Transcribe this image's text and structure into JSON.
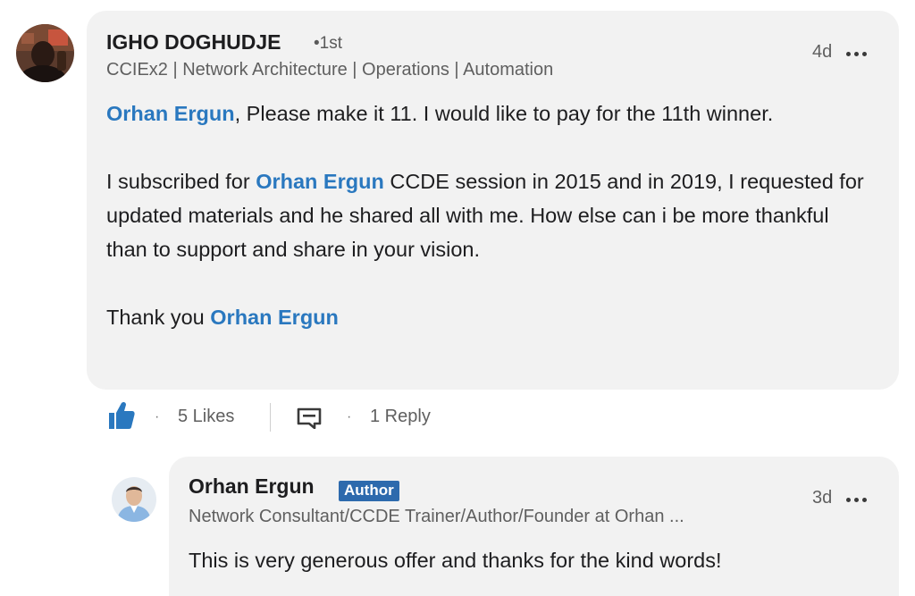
{
  "comment": {
    "author": {
      "name": "IGHO DOGHUDJE",
      "degree": "•1st",
      "headline": "CCIEx2 | Network Architecture | Operations | Automation",
      "avatar_icon": "user-photo-icon"
    },
    "timestamp": "4d",
    "more_icon": "more-options-icon",
    "body": {
      "p1_mention": "Orhan Ergun",
      "p1_text": ", Please make it 11. I would like to pay for the 11th winner.",
      "p2_pre": "I subscribed for ",
      "p2_mention": "Orhan Ergun",
      "p2_text": " CCDE session in 2015 and in 2019, I requested for updated materials and he shared all with me. How else can i be more thankful than to support and share in your vision.",
      "p3_pre": "Thank you ",
      "p3_mention": "Orhan Ergun"
    },
    "social": {
      "like_icon": "thumbs-up-icon",
      "likes": "5 Likes",
      "reply_icon": "comment-icon",
      "replies": "1 Reply"
    }
  },
  "reply": {
    "author": {
      "name": "Orhan Ergun",
      "badge": "Author",
      "headline": "Network Consultant/CCDE Trainer/Author/Founder at Orhan ...",
      "avatar_icon": "user-photo-icon"
    },
    "timestamp": "3d",
    "body": "This is very generous offer and thanks for the kind words!"
  },
  "colors": {
    "mention": "#2a78bf",
    "bubble": "#f2f2f2",
    "badge": "#2d6aad",
    "like": "#2a78bf"
  }
}
